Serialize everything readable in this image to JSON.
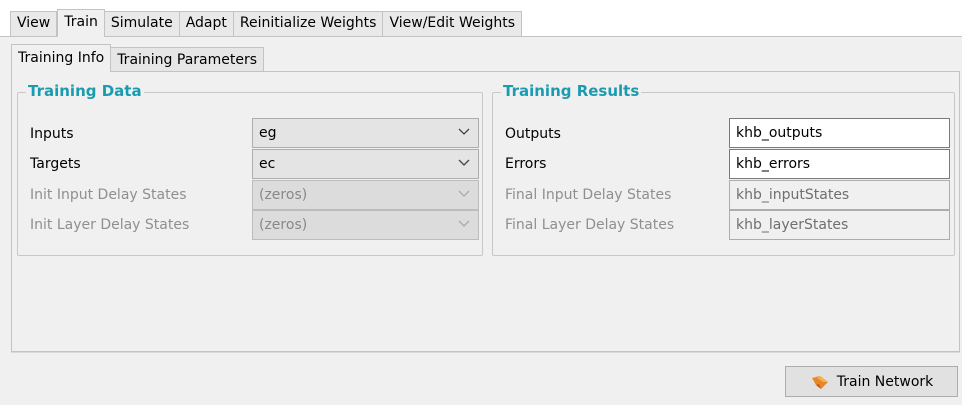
{
  "main_tabs": [
    "View",
    "Train",
    "Simulate",
    "Adapt",
    "Reinitialize Weights",
    "View/Edit Weights"
  ],
  "sub_tabs": [
    "Training Info",
    "Training Parameters"
  ],
  "training_data": {
    "title": "Training Data",
    "rows": [
      {
        "label": "Inputs",
        "value": "eg"
      },
      {
        "label": "Targets",
        "value": "ec"
      },
      {
        "label": "Init Input Delay States",
        "value": "(zeros)"
      },
      {
        "label": "Init Layer Delay States",
        "value": "(zeros)"
      }
    ]
  },
  "training_results": {
    "title": "Training Results",
    "rows": [
      {
        "label": "Outputs",
        "value": "khb_outputs"
      },
      {
        "label": "Errors",
        "value": "khb_errors"
      },
      {
        "label": "Final Input Delay States",
        "value": "khb_inputStates"
      },
      {
        "label": "Final Layer Delay States",
        "value": "khb_layerStates"
      }
    ]
  },
  "train_button": {
    "label": "Train Network",
    "icon": "train-network-icon"
  },
  "colors": {
    "accent": "#1b9bb0"
  }
}
